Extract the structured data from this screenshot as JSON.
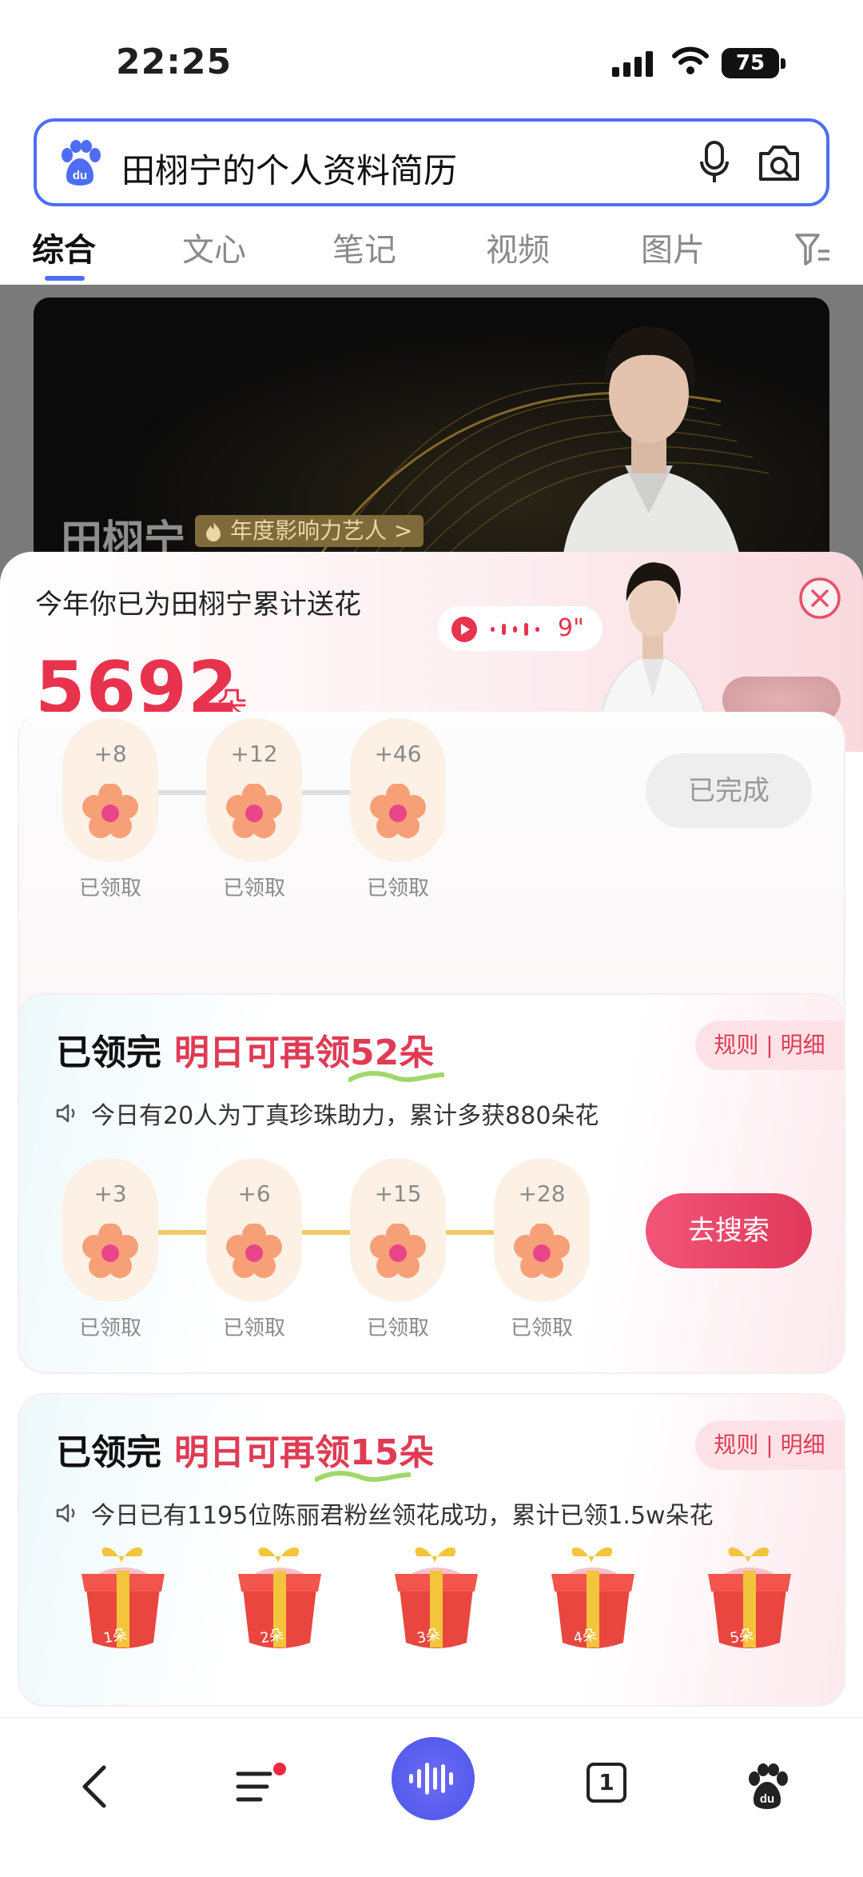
{
  "status": {
    "time": "22:25",
    "battery": "75"
  },
  "search": {
    "query": "田栩宁的个人资料简历"
  },
  "tabs": [
    {
      "label": "综合",
      "active": true
    },
    {
      "label": "文心"
    },
    {
      "label": "笔记"
    },
    {
      "label": "视频"
    },
    {
      "label": "图片"
    }
  ],
  "banner": {
    "name": "田栩宁",
    "badge": "年度影响力艺人"
  },
  "sheet": {
    "label": "今年你已为田栩宁累计送花",
    "count": "5692",
    "unit": "朵",
    "voice_duration": "9\""
  },
  "card1": {
    "flowers": [
      {
        "amount": "+8",
        "status": "已领取"
      },
      {
        "amount": "+12",
        "status": "已领取"
      },
      {
        "amount": "+46",
        "status": "已领取"
      }
    ],
    "button": "已完成"
  },
  "card2": {
    "title": "已领完",
    "title_red": "明日可再领52朵",
    "rules": "规则 | 明细",
    "subtitle": "今日有20人为丁真珍珠助力，累计多获880朵花",
    "flowers": [
      {
        "amount": "+3",
        "status": "已领取"
      },
      {
        "amount": "+6",
        "status": "已领取"
      },
      {
        "amount": "+15",
        "status": "已领取"
      },
      {
        "amount": "+28",
        "status": "已领取"
      }
    ],
    "button": "去搜索"
  },
  "card3": {
    "title": "已领完",
    "title_red": "明日可再领15朵",
    "rules": "规则 | 明细",
    "subtitle": "今日已有1195位陈丽君粉丝领花成功，累计已领1.5w朵花",
    "gifts": [
      "1朵",
      "2朵",
      "3朵",
      "4朵",
      "5朵"
    ]
  },
  "colors": {
    "accent_blue": "#4e6ef2",
    "accent_red": "#e8334e",
    "button_pink": "#e0385a"
  },
  "icons": [
    "baidu-paw-icon",
    "mic-icon",
    "camera-search-icon",
    "filter-icon",
    "fire-icon",
    "play-icon",
    "close-icon",
    "speaker-icon",
    "flower-icon",
    "gift-box-icon",
    "back-arrow-icon",
    "menu-icon",
    "voice-assistant-icon",
    "tabs-count-icon"
  ],
  "nav": {
    "tab_count": "1"
  }
}
